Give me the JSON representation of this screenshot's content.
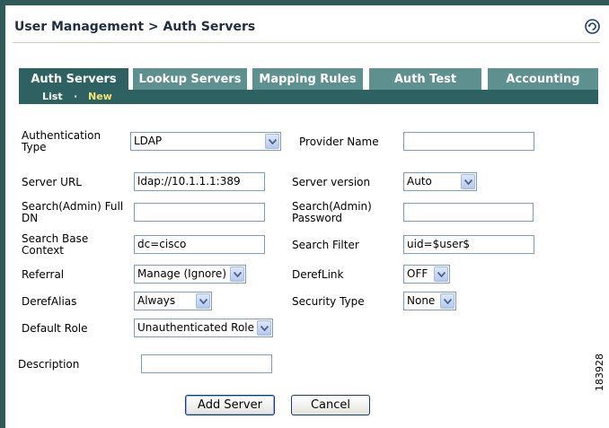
{
  "header": {
    "breadcrumb": "User Management > Auth Servers",
    "help_icon": "refresh-help-icon"
  },
  "tabs": [
    {
      "label": "Auth Servers",
      "active": true
    },
    {
      "label": "Lookup Servers",
      "active": false
    },
    {
      "label": "Mapping Rules",
      "active": false
    },
    {
      "label": "Auth Test",
      "active": false
    },
    {
      "label": "Accounting",
      "active": false
    }
  ],
  "subtabs": {
    "list": "List",
    "separator": "·",
    "new": "New"
  },
  "form": {
    "auth_type": {
      "label": "Authentication Type",
      "value": "LDAP"
    },
    "provider_name": {
      "label": "Provider Name",
      "value": ""
    },
    "server_url": {
      "label": "Server URL",
      "value": "ldap://10.1.1.1:389"
    },
    "server_version": {
      "label": "Server version",
      "value": "Auto"
    },
    "search_admin_dn": {
      "label": "Search(Admin) Full DN",
      "value": ""
    },
    "search_admin_password": {
      "label": "Search(Admin) Password",
      "value": ""
    },
    "search_base_context": {
      "label": "Search Base Context",
      "value": "dc=cisco"
    },
    "search_filter": {
      "label": "Search Filter",
      "value": "uid=$user$"
    },
    "referral": {
      "label": "Referral",
      "value": "Manage (Ignore)"
    },
    "dereflink": {
      "label": "DerefLink",
      "value": "OFF"
    },
    "derefalias": {
      "label": "DerefAlias",
      "value": "Always"
    },
    "security_type": {
      "label": "Security Type",
      "value": "None"
    },
    "default_role": {
      "label": "Default Role",
      "value": "Unauthenticated Role"
    },
    "description": {
      "label": "Description",
      "value": ""
    }
  },
  "buttons": {
    "add": "Add Server",
    "cancel": "Cancel"
  },
  "figure_id": "183928",
  "colors": {
    "tab_active": "#2e6262",
    "tab_inactive": "#5e9090",
    "new_link": "#f3e46a",
    "frame": "#2e5a58"
  }
}
